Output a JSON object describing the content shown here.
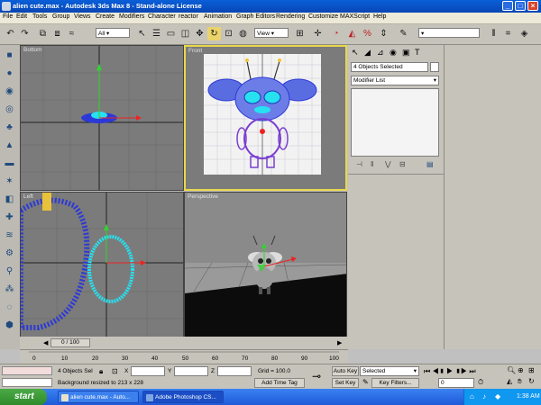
{
  "window": {
    "title": "alien cute.max - Autodesk 3ds Max 8 - Stand-alone License",
    "controls": [
      "_",
      "□",
      "×"
    ]
  },
  "menu": [
    "File",
    "Edit",
    "Tools",
    "Group",
    "Views",
    "Create",
    "Modifiers",
    "Character",
    "reactor",
    "Animation",
    "Graph Editors",
    "Rendering",
    "Customize",
    "MAXScript",
    "Help"
  ],
  "toolbar": {
    "selection_filter": "All",
    "coord_system": "View"
  },
  "viewports": {
    "top_left": "Bottom",
    "top_right": "Front",
    "bottom_left": "Left",
    "bottom_right": "Perspective"
  },
  "command_panel": {
    "selection": "4 Objects Selected",
    "modifier_list": "Modifier List"
  },
  "timeline": {
    "slider": "0 / 100",
    "ticks": [
      "0",
      "10",
      "20",
      "30",
      "40",
      "50",
      "60",
      "70",
      "80",
      "90",
      "100"
    ]
  },
  "status": {
    "objects_selected": "4 Objects Sel",
    "prompt": "Background resized to 213 x 228",
    "x_label": "X",
    "y_label": "Y",
    "z_label": "Z",
    "grid": "Grid = 100.0",
    "add_time_tag": "Add Time Tag",
    "auto_key": "Auto Key",
    "set_key": "Set Key",
    "key_mode": "Selected",
    "key_filters": "Key Filters...",
    "frame": "0"
  },
  "taskbar": {
    "start": "start",
    "tasks": [
      "alien cute.max - Auto...",
      "Adobe Photoshop CS..."
    ],
    "clock": "1:38 AM"
  },
  "colors": {
    "viewport_bg": "#7a7a7a",
    "active_border": "#e8d84a",
    "wire_cyan": "#27e0f0",
    "wire_blue": "#2c39d6",
    "taskbar": "#2f6fe8"
  }
}
